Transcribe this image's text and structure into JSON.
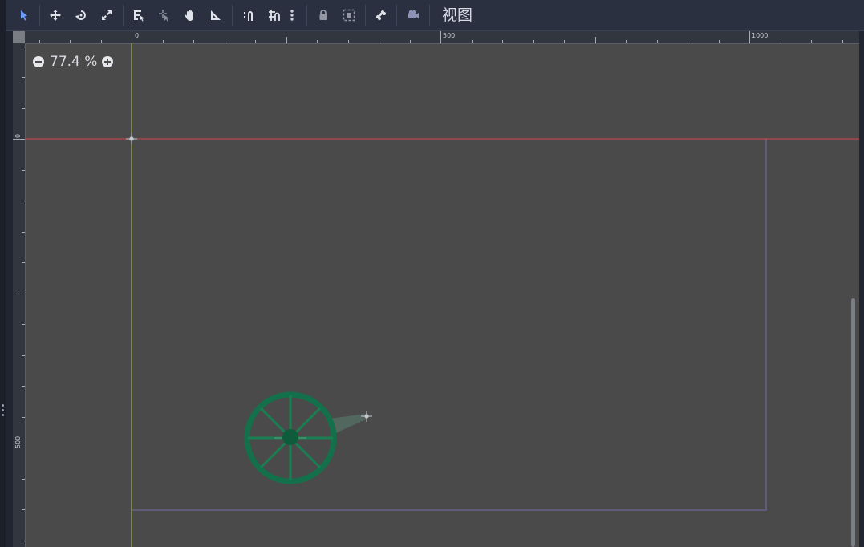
{
  "toolbar": {
    "tools": [
      {
        "name": "select-mode-button",
        "icon": "arrow-cursor-icon",
        "active": true
      },
      {
        "name": "move-mode-button",
        "icon": "move-arrows-icon"
      },
      {
        "name": "rotate-mode-button",
        "icon": "rotate-icon"
      },
      {
        "name": "scale-mode-button",
        "icon": "scale-icon"
      },
      {
        "name": "list-select-button",
        "icon": "list-select-icon"
      },
      {
        "name": "pivot-mode-button",
        "icon": "pivot-icon"
      },
      {
        "name": "pan-mode-button",
        "icon": "hand-icon"
      },
      {
        "name": "ruler-mode-button",
        "icon": "ruler-icon"
      },
      {
        "name": "smart-snap-button",
        "icon": "smart-snap-icon"
      },
      {
        "name": "grid-snap-button",
        "icon": "grid-snap-icon"
      },
      {
        "name": "snap-options-button",
        "icon": "kebab-menu-icon"
      },
      {
        "name": "lock-button",
        "icon": "lock-icon"
      },
      {
        "name": "group-button",
        "icon": "group-icon"
      },
      {
        "name": "skeleton-button",
        "icon": "bone-icon"
      },
      {
        "name": "camera-button",
        "icon": "camera-icon"
      }
    ],
    "view_menu_label": "视图"
  },
  "zoom": {
    "value": "77.4 %"
  },
  "rulers": {
    "horizontal_labels": [
      "0",
      "500",
      "1000"
    ],
    "vertical_labels": [
      "0",
      "500"
    ]
  },
  "colors": {
    "accent": "#6f9dff",
    "viewport_bg": "#4a4a4a",
    "axis_x": "#d64545",
    "axis_y": "#a9c842",
    "viewport_border": "#7a6aa8",
    "wheel": "#14704a"
  }
}
